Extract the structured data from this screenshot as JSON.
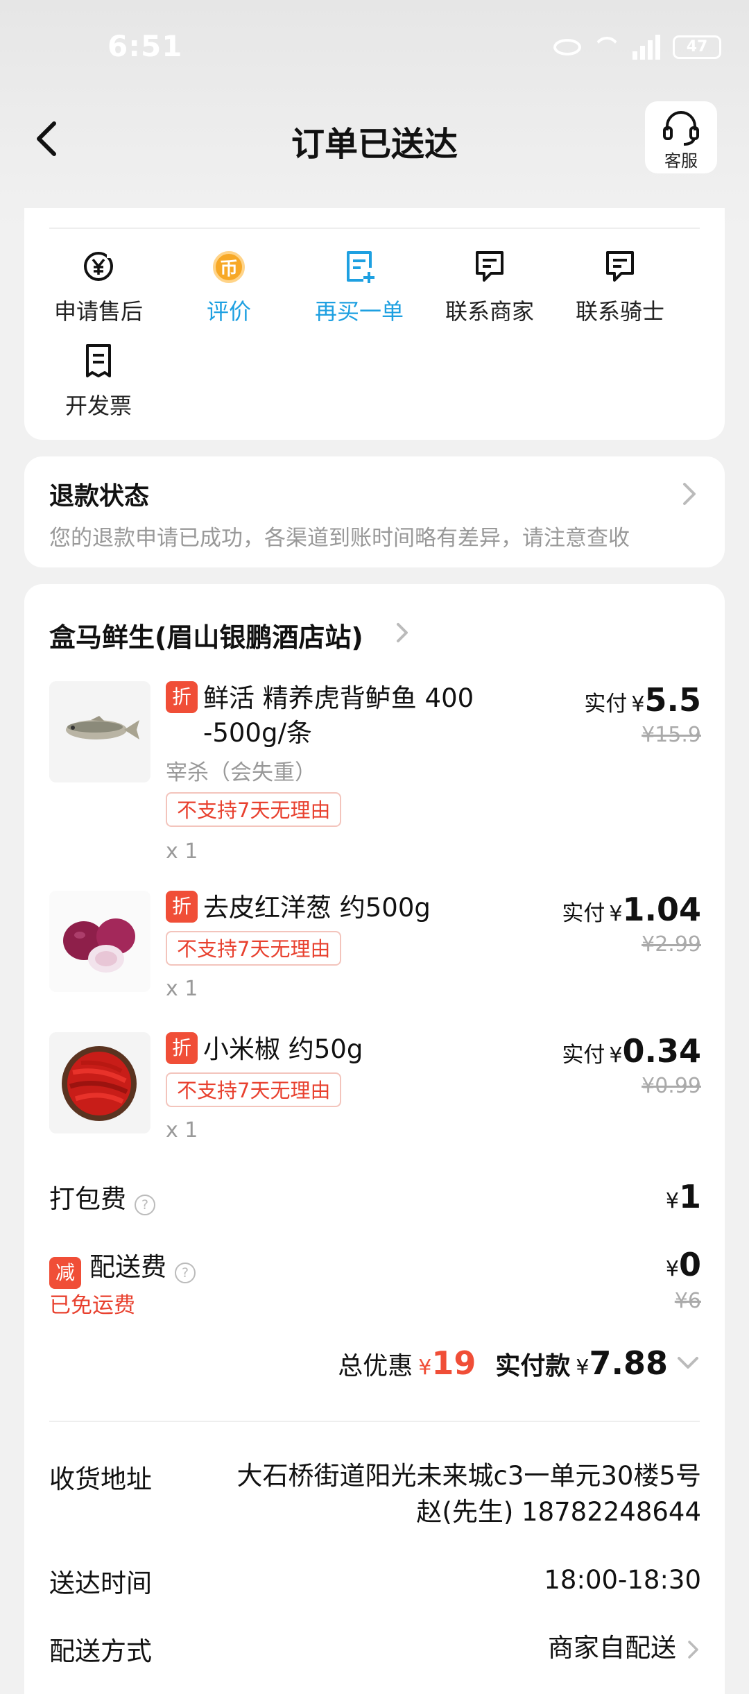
{
  "status_bar": {
    "time": "6:51",
    "battery": "47"
  },
  "header": {
    "title": "订单已送达",
    "service_label": "客服"
  },
  "actions": [
    {
      "label": "申请售后",
      "icon": "yen-circle-icon"
    },
    {
      "label": "评价",
      "icon": "coin-icon"
    },
    {
      "label": "再买一单",
      "icon": "rebuy-icon"
    },
    {
      "label": "联系商家",
      "icon": "chat-icon"
    },
    {
      "label": "联系骑士",
      "icon": "chat-icon"
    },
    {
      "label": "开发票",
      "icon": "receipt-icon"
    }
  ],
  "refund": {
    "title": "退款状态",
    "desc": "您的退款申请已成功，各渠道到账时间略有差异，请注意查收"
  },
  "store": {
    "name": "盒马鲜生(眉山银鹏酒店站)"
  },
  "labels": {
    "discount_tag": "折",
    "reduce_tag": "减",
    "paid_label": "实付",
    "currency": "¥",
    "no_return": "不支持7天无理由",
    "help": "?"
  },
  "items": [
    {
      "name_line1": "鲜活 精养虎背鲈鱼 400",
      "name_line2": "-500g/条",
      "sub": "宰杀（会失重）",
      "qty": "x 1",
      "paid": "5.5",
      "original": "¥15.9",
      "image": "fish"
    },
    {
      "name_line1": "去皮红洋葱 约500g",
      "qty": "x 1",
      "paid": "1.04",
      "original": "¥2.99",
      "image": "onion"
    },
    {
      "name_line1": "小米椒 约50g",
      "qty": "x 1",
      "paid": "0.34",
      "original": "¥0.99",
      "image": "chili"
    }
  ],
  "fees": {
    "packing_label": "打包费",
    "packing_value": "1",
    "delivery_label": "配送费",
    "delivery_value": "0",
    "delivery_original": "¥6",
    "free_note": "已免运费"
  },
  "totals": {
    "discount_label": "总优惠",
    "discount_value": "19",
    "paid_label": "实付款",
    "paid_value": "7.88"
  },
  "info": {
    "address_label": "收货地址",
    "address_line1": "大石桥街道阳光未来城c3一单元30楼5号",
    "address_line2": "赵(先生) 18782248644",
    "time_label": "送达时间",
    "time_value": "18:00-18:30",
    "method_label": "配送方式",
    "method_value": "商家自配送"
  },
  "colors": {
    "accent_red": "#f04e37",
    "accent_blue": "#1ea0e1",
    "coin": "#f7a826"
  }
}
